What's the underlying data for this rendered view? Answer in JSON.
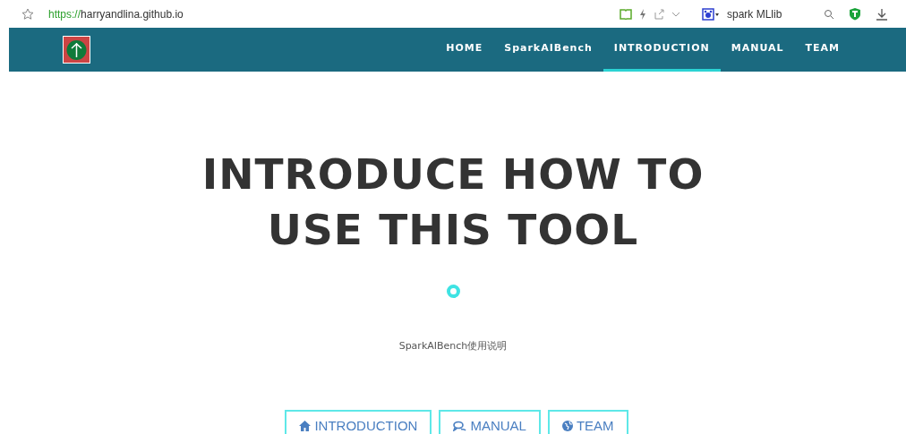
{
  "browser": {
    "url_scheme": "https://",
    "url_host": "harryandlina.github.io",
    "search_text": "spark MLlib"
  },
  "nav": {
    "items": [
      {
        "label": "HOME",
        "selected": false
      },
      {
        "label": "SparkAIBench",
        "selected": false
      },
      {
        "label": "INTRODUCTION",
        "selected": true
      },
      {
        "label": "MANUAL",
        "selected": false
      },
      {
        "label": "TEAM",
        "selected": false
      }
    ]
  },
  "hero": {
    "title_lines": [
      "INTRODUCE HOW TO",
      "USE THIS TOOL"
    ],
    "subtitle": "SparkAIBench使用说明"
  },
  "buttons": [
    {
      "kind": "home",
      "label": "INTRODUCTION"
    },
    {
      "kind": "chat",
      "label": "MANUAL"
    },
    {
      "kind": "globe",
      "label": "TEAM"
    }
  ]
}
